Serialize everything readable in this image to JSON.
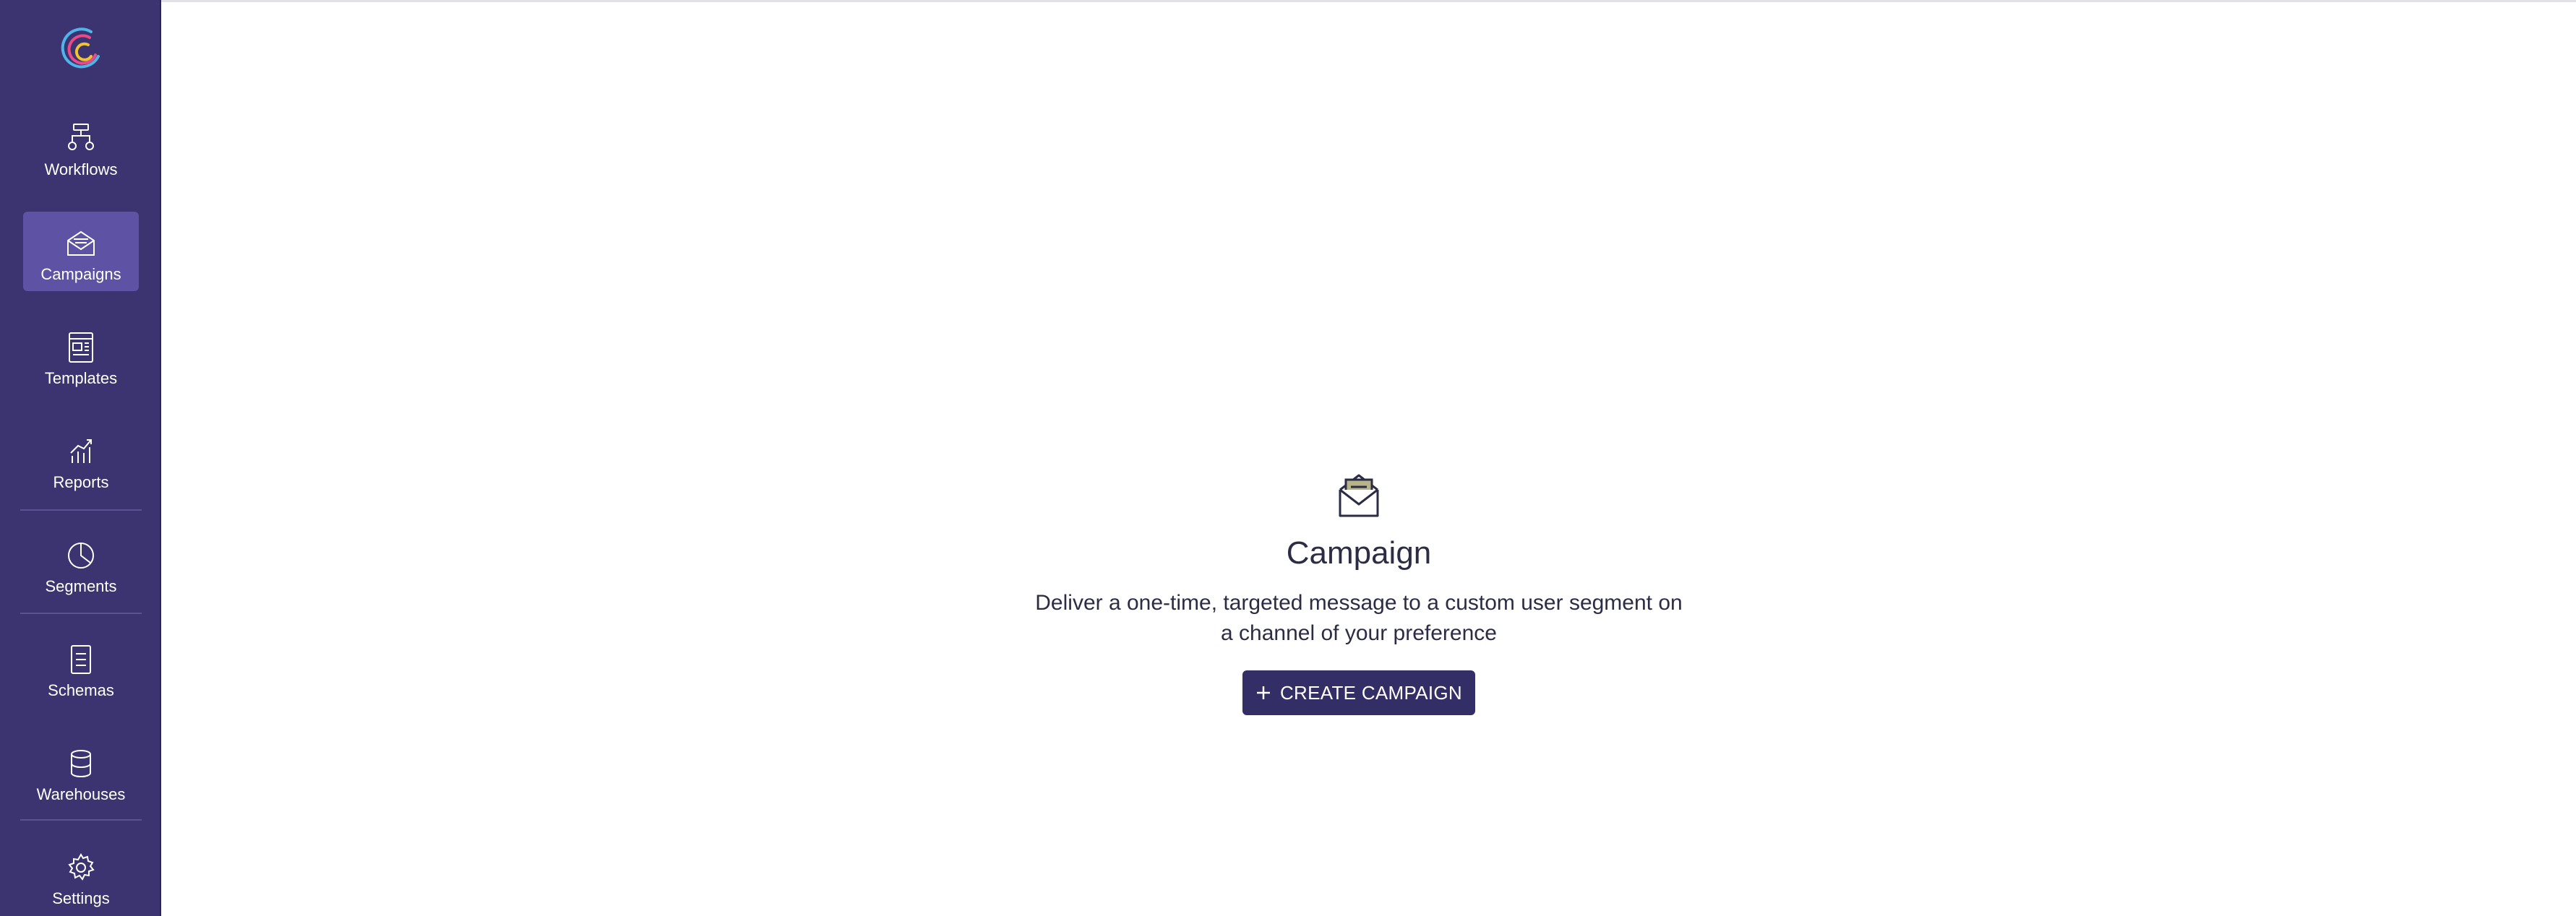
{
  "sidebar": {
    "logo_name": "app-logo",
    "items": [
      {
        "label": "Workflows",
        "icon": "workflow-icon",
        "active": false
      },
      {
        "label": "Campaigns",
        "icon": "envelope-open-icon",
        "active": true
      },
      {
        "label": "Templates",
        "icon": "template-icon",
        "active": false
      },
      {
        "label": "Reports",
        "icon": "chart-icon",
        "active": false
      },
      {
        "label": "Segments",
        "icon": "pie-chart-icon",
        "active": false
      },
      {
        "label": "Schemas",
        "icon": "document-icon",
        "active": false
      },
      {
        "label": "Warehouses",
        "icon": "database-icon",
        "active": false
      },
      {
        "label": "Settings",
        "icon": "gear-icon",
        "active": false
      }
    ]
  },
  "empty_state": {
    "icon": "envelope-open-icon",
    "title": "Campaign",
    "description": "Deliver a one-time, targeted message to a custom user segment on a channel of your preference",
    "button_label": "CREATE CAMPAIGN"
  },
  "colors": {
    "sidebar_bg": "#3b3470",
    "sidebar_active": "#5d52a4",
    "button_bg": "#342e66",
    "text_dark": "#2c2d45"
  }
}
